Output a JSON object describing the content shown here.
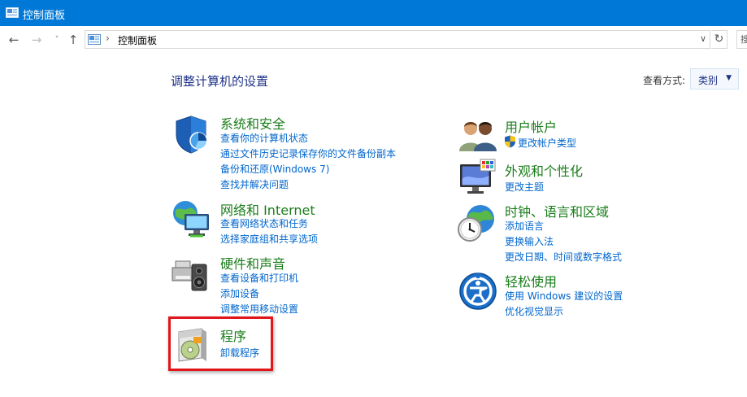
{
  "window": {
    "title": "控制面板"
  },
  "nav": {
    "back_glyph": "←",
    "forward_glyph": "→",
    "recent_glyph": "˅",
    "up_glyph": "↑"
  },
  "address": {
    "separator": "›",
    "crumb": "控制面板",
    "dropdown_glyph": "∨",
    "refresh_glyph": "↻",
    "search_partial": "搜"
  },
  "main": {
    "heading": "调整计算机的设置",
    "view_by_label": "查看方式:",
    "view_by_value": "类别",
    "view_by_caret": "▼"
  },
  "categories": [
    {
      "title": "系统和安全",
      "icon": "system-security-icon",
      "links": [
        "查看你的计算机状态",
        "通过文件历史记录保存你的文件备份副本",
        "备份和还原(Windows 7)",
        "查找并解决问题"
      ]
    },
    {
      "title": "网络和 Internet",
      "icon": "network-internet-icon",
      "links": [
        "查看网络状态和任务",
        "选择家庭组和共享选项"
      ]
    },
    {
      "title": "硬件和声音",
      "icon": "hardware-sound-icon",
      "links": [
        "查看设备和打印机",
        "添加设备",
        "调整常用移动设置"
      ]
    },
    {
      "title": "程序",
      "icon": "programs-icon",
      "links": [
        "卸载程序"
      ]
    },
    {
      "title": "用户帐户",
      "icon": "user-accounts-icon",
      "links": [
        "更改帐户类型"
      ]
    },
    {
      "title": "外观和个性化",
      "icon": "appearance-personalization-icon",
      "links": [
        "更改主题"
      ]
    },
    {
      "title": "时钟、语言和区域",
      "icon": "clock-language-region-icon",
      "links": [
        "添加语言",
        "更换输入法",
        "更改日期、时间或数字格式"
      ]
    },
    {
      "title": "轻松使用",
      "icon": "ease-of-access-icon",
      "links": [
        "使用 Windows 建议的设置",
        "优化视觉显示"
      ]
    }
  ],
  "colors": {
    "titlebar": "#0078d7",
    "category_title": "#1a7d1a",
    "link": "#0066cc",
    "heading": "#1e3287",
    "highlight_border": "#e0161b"
  }
}
